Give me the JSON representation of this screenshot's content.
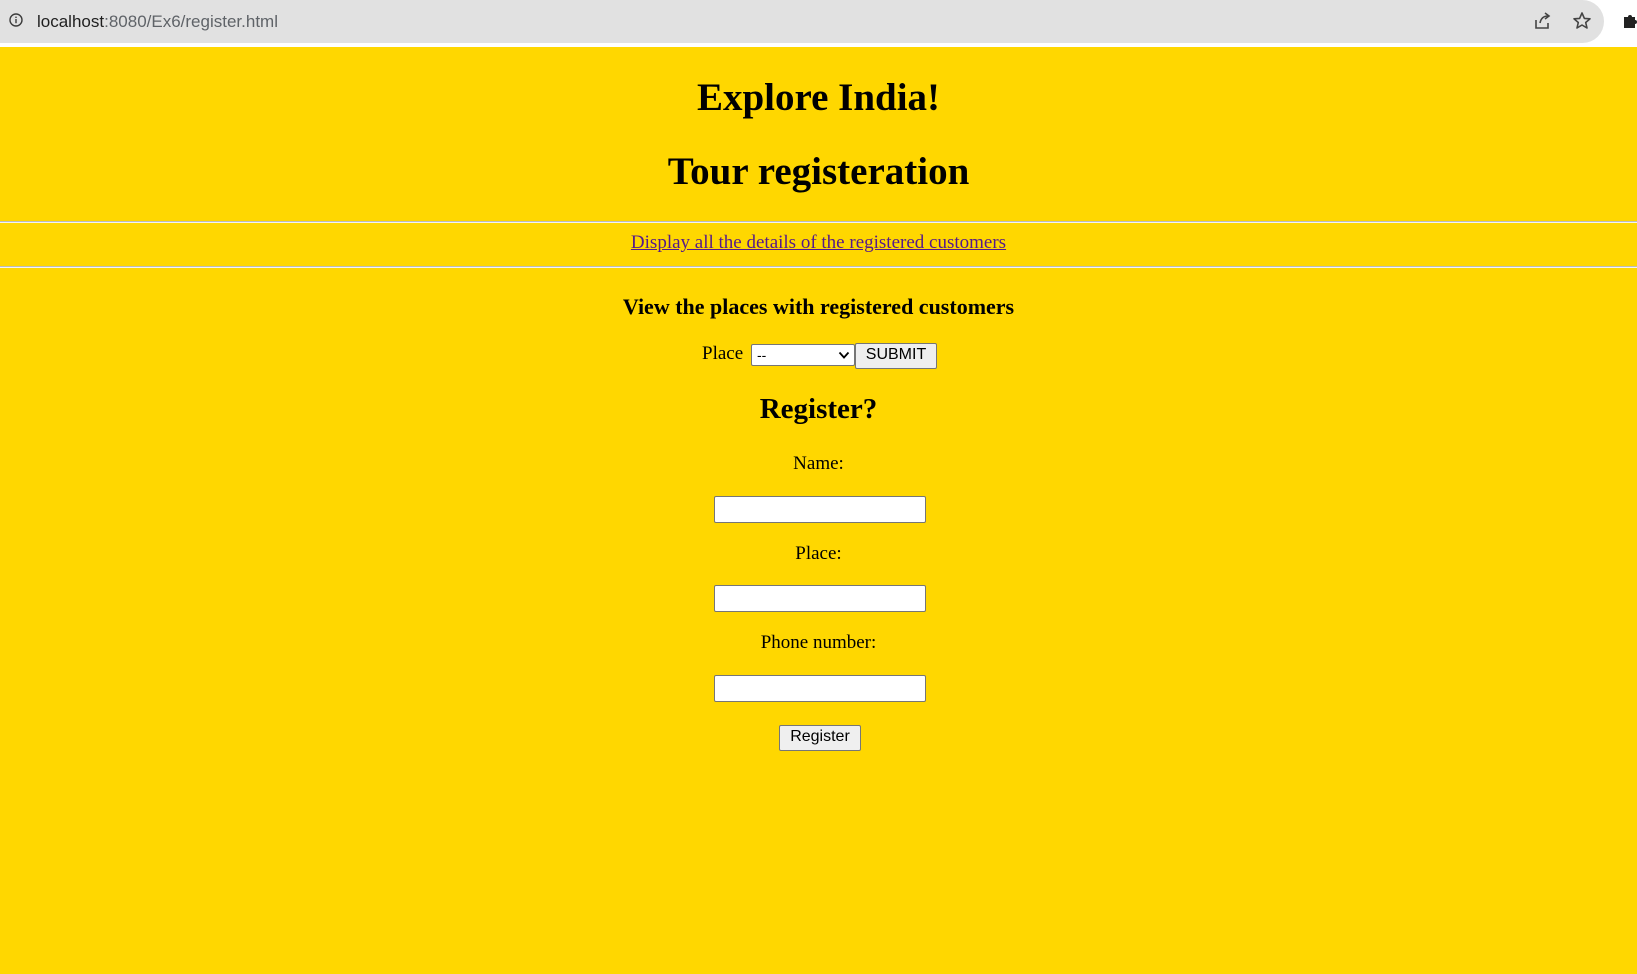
{
  "browser": {
    "url_host": "localhost",
    "url_rest": ":8080/Ex6/register.html",
    "icons": [
      "info-icon",
      "share-icon",
      "star-icon",
      "extensions-icon"
    ]
  },
  "page": {
    "background_color": "#FFD700",
    "title": "Explore India!",
    "subtitle": "Tour registeration",
    "details_link": "Display all the details of the registered customers",
    "places_heading": "View the places with registered customers",
    "place_label": "Place",
    "place_select_value": "--",
    "submit_label": "SUBMIT",
    "register_heading": "Register?",
    "form": {
      "name_label": "Name:",
      "name_value": "",
      "place_label": "Place:",
      "place_value": "",
      "phone_label": "Phone number:",
      "phone_value": "",
      "register_label": "Register"
    }
  }
}
